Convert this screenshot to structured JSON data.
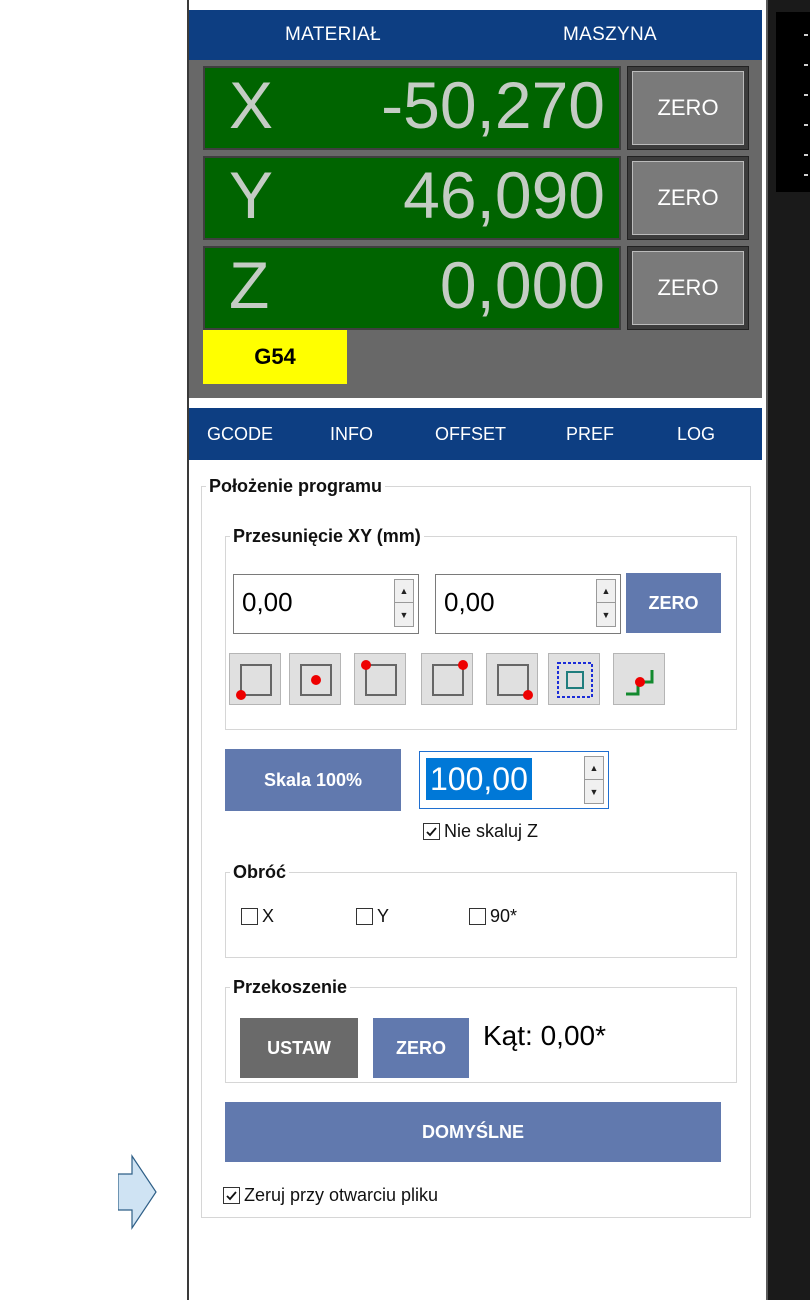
{
  "dro": {
    "tab_left": "MATERIAŁ",
    "tab_right": "MASZYNA",
    "axes": [
      {
        "letter": "X",
        "value": "-50,270",
        "zero_label": "ZERO"
      },
      {
        "letter": "Y",
        "value": "46,090",
        "zero_label": "ZERO"
      },
      {
        "letter": "Z",
        "value": "0,000",
        "zero_label": "ZERO"
      }
    ],
    "work_offset": "G54"
  },
  "tabs": [
    "GCODE",
    "INFO",
    "OFFSET",
    "PREF",
    "LOG"
  ],
  "program_position": {
    "title": "Położenie programu",
    "xy_offset": {
      "title": "Przesunięcie XY (mm)",
      "x_value": "0,00",
      "y_value": "0,00",
      "zero_label": "ZERO",
      "position_buttons": [
        "bottom-left-icon",
        "center-icon",
        "top-left-icon",
        "top-right-icon",
        "bottom-right-icon",
        "bounding-box-icon",
        "current-position-icon"
      ]
    },
    "scale": {
      "button_label": "Skala 100%",
      "value": "100,00",
      "no_scale_z_label": "Nie skaluj Z",
      "no_scale_z_checked": true
    },
    "rotate": {
      "title": "Obróć",
      "options": [
        {
          "label": "X",
          "checked": false
        },
        {
          "label": "Y",
          "checked": false
        },
        {
          "label": "90*",
          "checked": false
        }
      ]
    },
    "skew": {
      "title": "Przekoszenie",
      "set_label": "USTAW",
      "zero_label": "ZERO",
      "angle_text": "Kąt: 0,00*"
    },
    "defaults_label": "DOMYŚLNE",
    "zero_on_open_label": "Zeruj przy otwarciu pliku",
    "zero_on_open_checked": true
  },
  "colors": {
    "header_blue": "#0d3e82",
    "dro_green": "#006400",
    "button_blue": "#6179ae",
    "offset_yellow": "#ffff00",
    "arrow_fill": "#cfe3f3"
  }
}
